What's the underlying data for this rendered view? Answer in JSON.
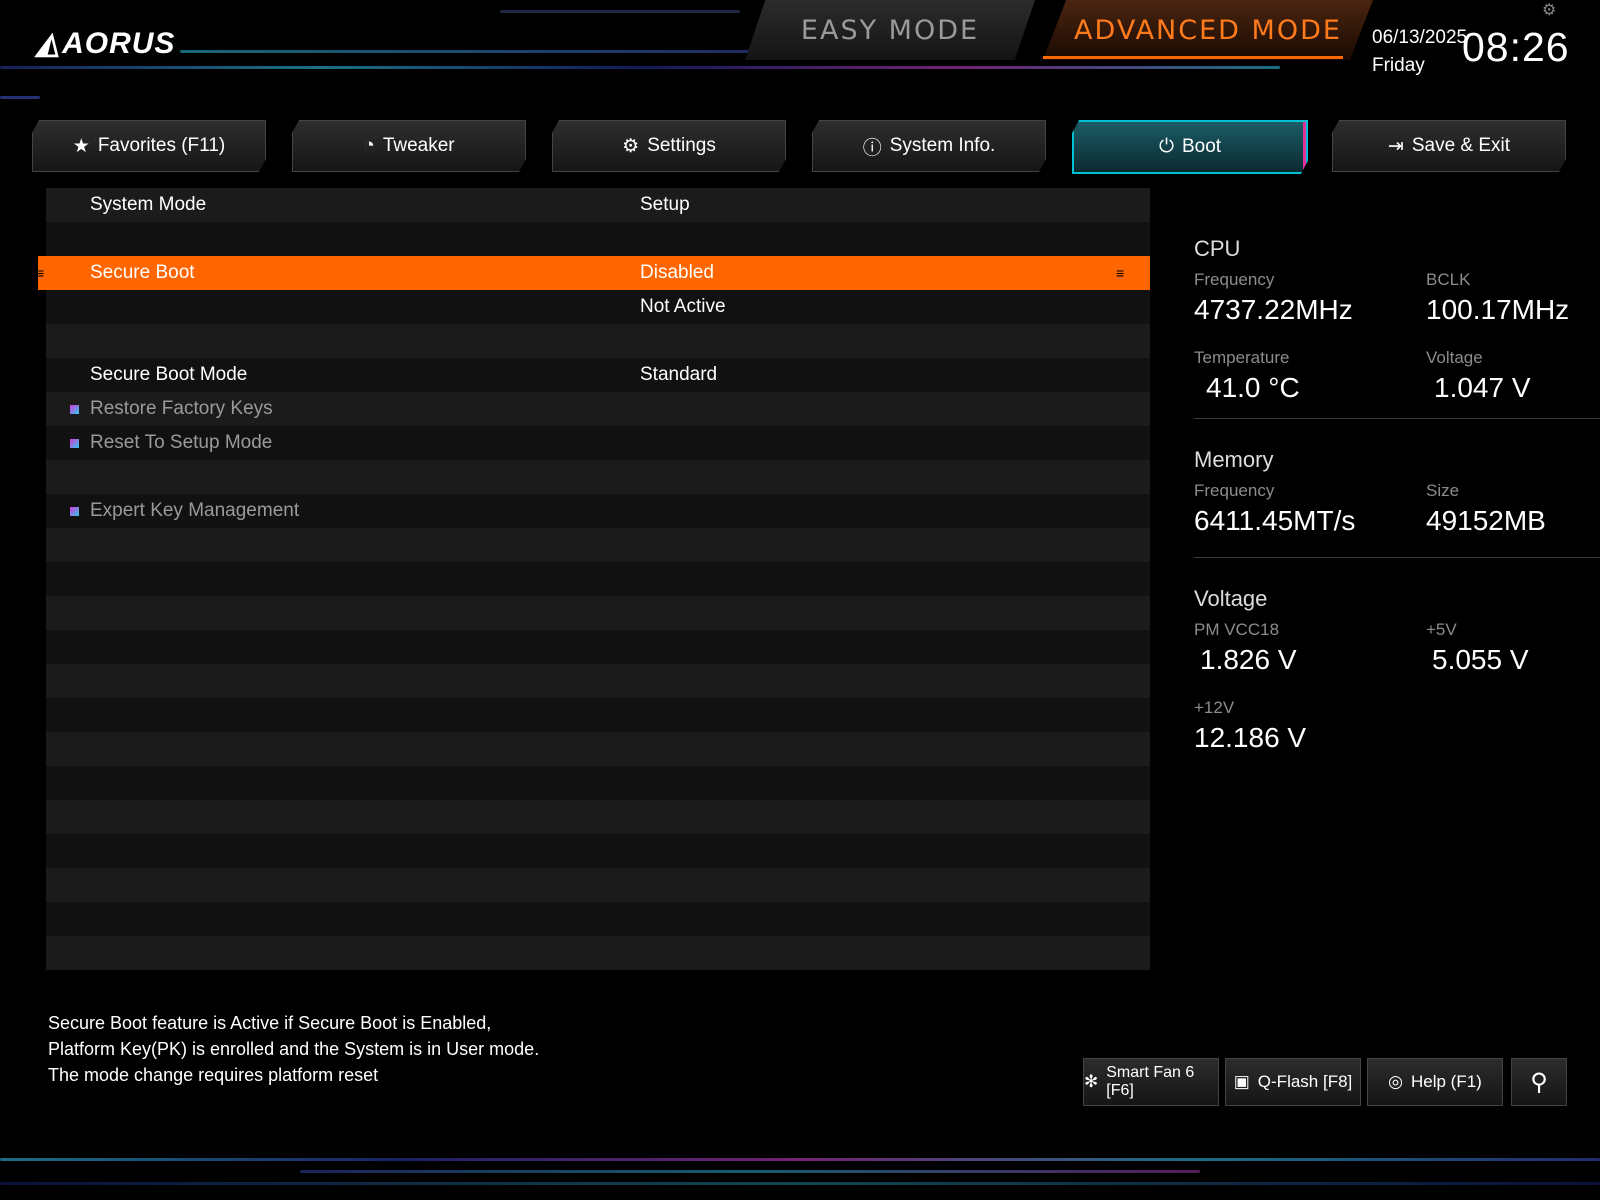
{
  "header": {
    "logo": "AORUS",
    "modes": {
      "easy": "EASY MODE",
      "advanced": "ADVANCED MODE"
    },
    "date": "06/13/2025",
    "day": "Friday",
    "time": "08:26"
  },
  "tabs": [
    {
      "label": "Favorites (F11)",
      "icon": "star-folder-icon"
    },
    {
      "label": "Tweaker",
      "icon": "speedometer-icon"
    },
    {
      "label": "Settings",
      "icon": "gear-icon"
    },
    {
      "label": "System Info.",
      "icon": "info-icon"
    },
    {
      "label": "Boot",
      "icon": "power-icon",
      "active": true
    },
    {
      "label": "Save & Exit",
      "icon": "exit-icon"
    }
  ],
  "settings": {
    "system_mode": {
      "label": "System Mode",
      "value": "Setup"
    },
    "secure_boot": {
      "label": "Secure Boot",
      "value": "Disabled",
      "status": "Not Active"
    },
    "secure_boot_mode": {
      "label": "Secure Boot Mode",
      "value": "Standard"
    },
    "restore_factory_keys": "Restore Factory Keys",
    "reset_to_setup_mode": "Reset To Setup Mode",
    "expert_key_management": "Expert Key Management"
  },
  "info": {
    "cpu": {
      "title": "CPU",
      "frequency_label": "Frequency",
      "frequency": "4737.22MHz",
      "bclk_label": "BCLK",
      "bclk": "100.17MHz",
      "temperature_label": "Temperature",
      "temperature": "41.0 °C",
      "voltage_label": "Voltage",
      "voltage": "1.047 V"
    },
    "memory": {
      "title": "Memory",
      "frequency_label": "Frequency",
      "frequency": "6411.45MT/s",
      "size_label": "Size",
      "size": "49152MB"
    },
    "voltage": {
      "title": "Voltage",
      "pmvcc18_label": "PM VCC18",
      "pmvcc18": "1.826 V",
      "p5v_label": "+5V",
      "p5v": "5.055 V",
      "p12v_label": "+12V",
      "p12v": "12.186 V"
    }
  },
  "help": {
    "line1": "Secure Boot feature is Active if Secure Boot is Enabled,",
    "line2": "Platform Key(PK) is enrolled and the System is in User mode.",
    "line3": "The mode change requires platform reset"
  },
  "bottom": {
    "smart_fan": "Smart Fan 6 [F6]",
    "qflash": "Q-Flash [F8]",
    "help": "Help (F1)"
  },
  "colors": {
    "accent": "#ff6600",
    "active_tab": "#00c2d4",
    "pink": "#e0309a"
  }
}
